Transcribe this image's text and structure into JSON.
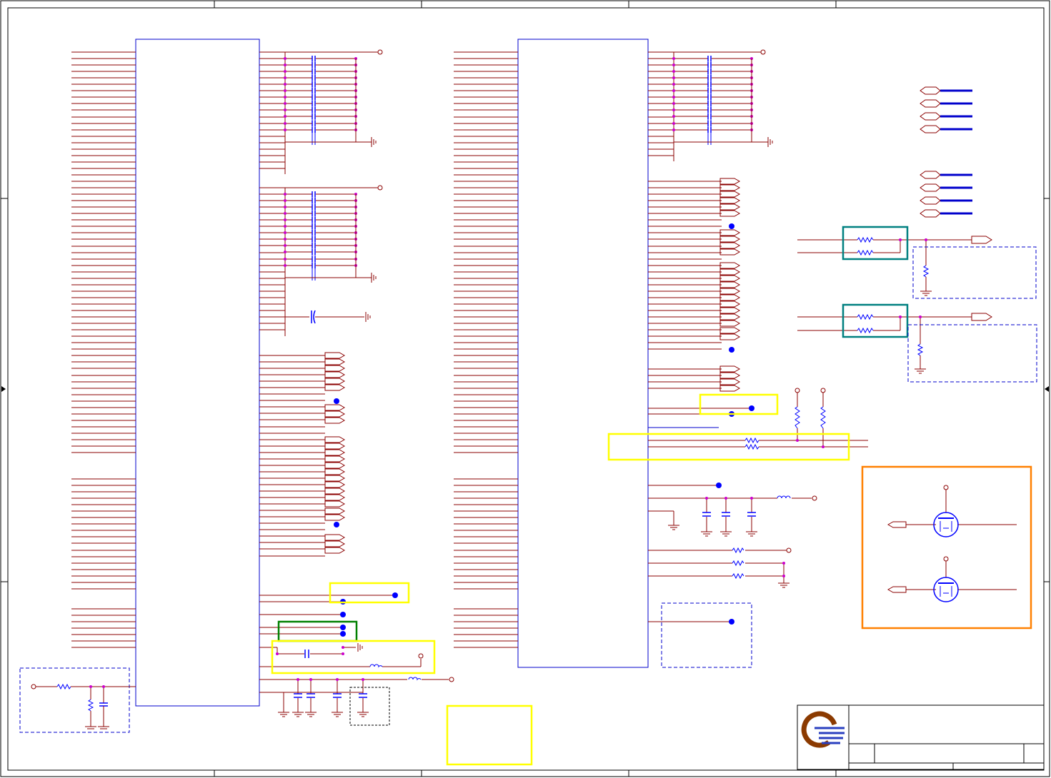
{
  "sheet": {
    "background": "#ffffff",
    "line_color": "#8b0000",
    "border_color": "#000000",
    "component_color": "#0000ff",
    "junction_color": "#cc00cc",
    "highlight_colors": {
      "yellow": "#ffff00",
      "teal": "#008080",
      "green": "#008000",
      "orange": "#ff8000",
      "blue_dashed": "#0000cc"
    }
  },
  "title_block": {
    "logo_icon": "company-logo-icon",
    "logo_colors": [
      "#8b3a00",
      "#2a3fbf"
    ]
  },
  "icons": {
    "ground": "ground-symbol-icon",
    "capacitor": "capacitor-icon",
    "resistor": "resistor-icon",
    "inductor": "inductor-icon",
    "mosfet": "mosfet-icon",
    "port": "offpage-port-icon",
    "power_pin": "power-pin-circle-icon",
    "no_connect": "no-connect-dot-icon"
  }
}
